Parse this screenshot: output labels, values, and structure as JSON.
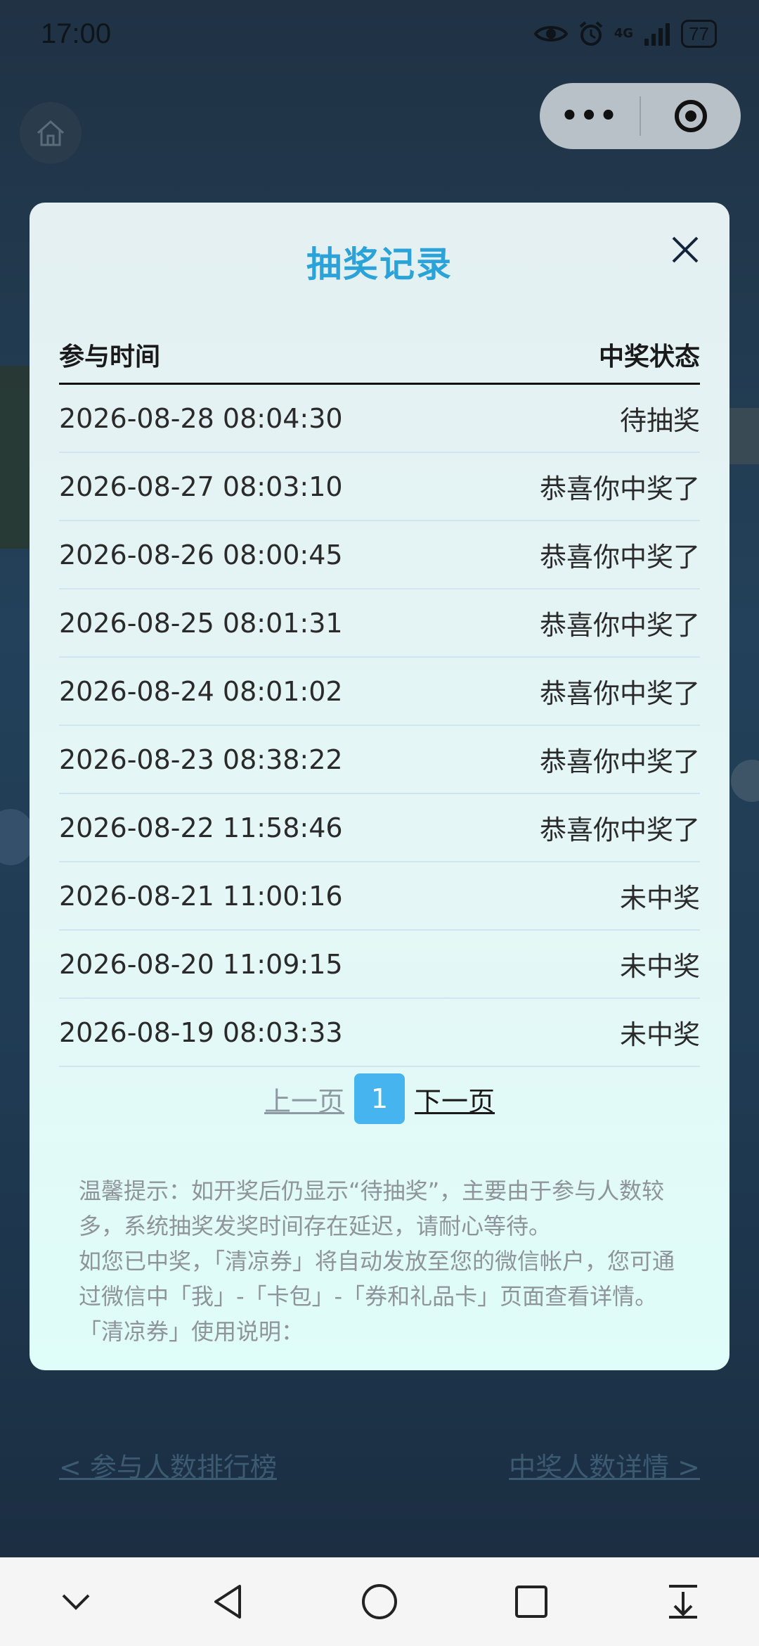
{
  "status_bar": {
    "time": "17:00",
    "network": "4G",
    "battery": "77"
  },
  "capsule": {
    "more_label": "•••"
  },
  "modal": {
    "title": "抽奖记录",
    "columns": {
      "time": "参与时间",
      "status": "中奖状态"
    },
    "rows": [
      {
        "time": "2026-08-28 08:04:30",
        "status": "待抽奖"
      },
      {
        "time": "2026-08-27 08:03:10",
        "status": "恭喜你中奖了"
      },
      {
        "time": "2026-08-26 08:00:45",
        "status": "恭喜你中奖了"
      },
      {
        "time": "2026-08-25 08:01:31",
        "status": "恭喜你中奖了"
      },
      {
        "time": "2026-08-24 08:01:02",
        "status": "恭喜你中奖了"
      },
      {
        "time": "2026-08-23 08:38:22",
        "status": "恭喜你中奖了"
      },
      {
        "time": "2026-08-22 11:58:46",
        "status": "恭喜你中奖了"
      },
      {
        "time": "2026-08-21 11:00:16",
        "status": "未中奖"
      },
      {
        "time": "2026-08-20 11:09:15",
        "status": "未中奖"
      },
      {
        "time": "2026-08-19 08:03:33",
        "status": "未中奖"
      }
    ],
    "pager": {
      "prev": "上一页",
      "current": "1",
      "next": "下一页"
    },
    "notes": [
      "温馨提示：如开奖后仍显示“待抽奖”，主要由于参与人数较多，系统抽奖发奖时间存在延迟，请耐心等待。",
      "如您已中奖，「清凉券」将自动发放至您的微信帐户，您可通过微信中「我」-「卡包」-「券和礼品卡」页面查看详情。",
      "「清凉券」使用说明："
    ]
  },
  "bottom_links": {
    "left": "< 参与人数排行榜",
    "right": "中奖人数详情 >"
  },
  "colors": {
    "title": "#2ba3d8",
    "page_active": "#46b4ef",
    "row_divider": "#cfe6f2"
  }
}
